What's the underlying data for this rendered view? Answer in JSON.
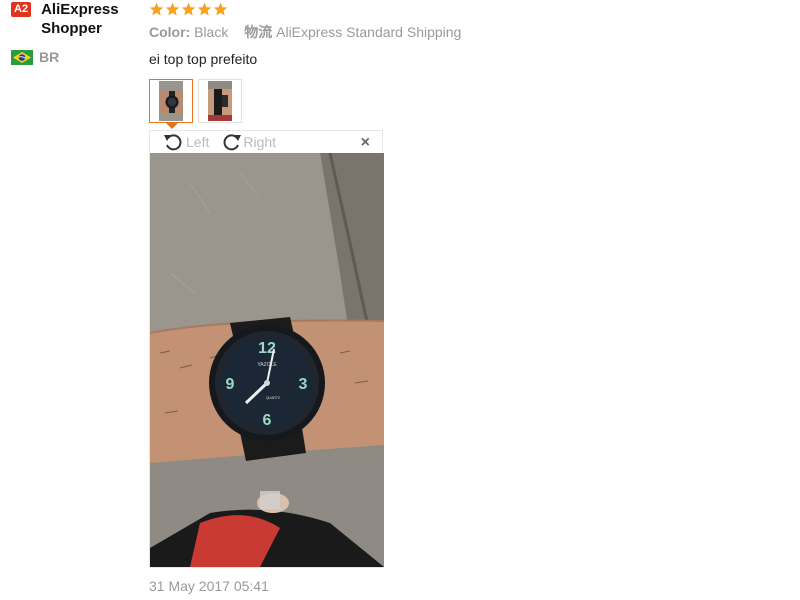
{
  "user": {
    "level": "A2",
    "name": "AliExpress Shopper",
    "country_code": "BR",
    "flag_icon": "brazil-flag-icon"
  },
  "review": {
    "rating": 5,
    "rating_max": 5,
    "star_color": "#f7a21b",
    "color_label": "Color:",
    "color_value": "Black",
    "shipping_label": "物流",
    "shipping_value": "AliExpress Standard Shipping",
    "comment": "ei top top prefeito",
    "date": "31 May 2017 05:41"
  },
  "viewer": {
    "rotate_left_label": "Left",
    "rotate_right_label": "Right",
    "close_label": "×",
    "accent_color": "#e8731b"
  },
  "thumbnails": [
    {
      "name": "review-photo-1",
      "active": true
    },
    {
      "name": "review-photo-2",
      "active": false
    }
  ],
  "watch_dial": {
    "brand": "YAZOLE",
    "label": "QUARTZ",
    "numerals": [
      "12",
      "3",
      "6",
      "9"
    ]
  }
}
